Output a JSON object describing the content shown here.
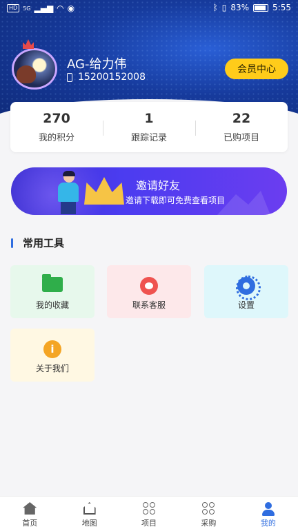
{
  "status_bar": {
    "network_chip": "HD",
    "signal_label": "5G",
    "battery_percent": "83%",
    "time": "5:55"
  },
  "profile": {
    "name": "AG-给力伟",
    "phone": "15200152008",
    "vip_button": "会员中心"
  },
  "stats": [
    {
      "value": "270",
      "label": "我的积分"
    },
    {
      "value": "1",
      "label": "跟踪记录"
    },
    {
      "value": "22",
      "label": "已购项目"
    }
  ],
  "banner": {
    "title": "邀请好友",
    "subtitle": "邀请下载即可免费查看项目"
  },
  "tools_section": {
    "title": "常用工具",
    "items": [
      {
        "label": "我的收藏",
        "icon": "folder-icon"
      },
      {
        "label": "联系客服",
        "icon": "customer-service-icon"
      },
      {
        "label": "设置",
        "icon": "gear-icon"
      },
      {
        "label": "关于我们",
        "icon": "info-icon"
      }
    ]
  },
  "tabbar": {
    "active_index": 4,
    "items": [
      {
        "label": "首页",
        "icon": "home-icon"
      },
      {
        "label": "地图",
        "icon": "map-icon"
      },
      {
        "label": "项目",
        "icon": "grid-icon"
      },
      {
        "label": "采购",
        "icon": "grid-icon"
      },
      {
        "label": "我的",
        "icon": "user-icon"
      }
    ]
  },
  "colors": {
    "accent": "#2f6de0",
    "vip_button": "#ffcc1a",
    "header_bg": "#163a9c"
  }
}
